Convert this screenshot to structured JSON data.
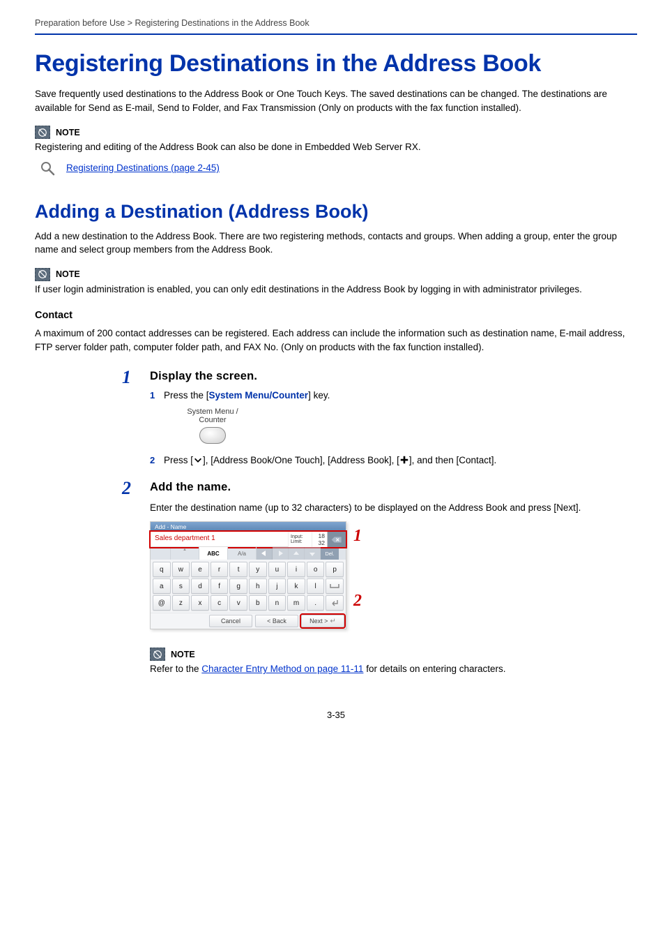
{
  "breadcrumb": "Preparation before Use > Registering Destinations in the Address Book",
  "h1": "Registering Destinations in the Address Book",
  "intro": "Save frequently used destinations to the Address Book or One Touch Keys. The saved destinations can be changed. The destinations are available for Send as E-mail, Send to Folder, and Fax Transmission (Only on products with the fax function installed).",
  "note_label": "NOTE",
  "note1_text": "Registering and editing of the Address Book can also be done in Embedded Web Server RX.",
  "ref1_link": "Registering Destinations (page 2-45)",
  "h2": "Adding a Destination (Address Book)",
  "h2_intro": "Add a new destination to the Address Book. There are two registering methods, contacts and groups. When adding a group, enter the group name and select group members from the Address Book.",
  "note2_text": "If user login administration is enabled, you can only edit destinations in the Address Book by logging in with administrator privileges.",
  "contact_heading": "Contact",
  "contact_text": "A maximum of 200 contact addresses can be registered. Each address can include the information such as destination name, E-mail address, FTP server folder path, computer folder path, and FAX No. (Only on products with the fax function installed).",
  "step1": {
    "num": "1",
    "title": "Display the screen.",
    "sub1_num": "1",
    "sub1_a": "Press the [",
    "sub1_kw": "System Menu/Counter",
    "sub1_b": "] key.",
    "key_label_top": "System Menu /",
    "key_label_bot": "Counter",
    "sub2_num": "2",
    "sub2_text_a": "Press [",
    "sub2_text_b": "], [Address Book/One Touch], [Address Book], [",
    "sub2_text_c": "], and then [Contact]."
  },
  "step2": {
    "num": "2",
    "title": "Add the name.",
    "desc": "Enter the destination name (up to 32 characters) to be displayed on the Address Book and press [Next].",
    "callout1": "1",
    "callout2": "2"
  },
  "kbd": {
    "titlebar": "Add - Name",
    "input_value": "Sales department 1",
    "limit_label_top": "Input:",
    "limit_label_bot": "Limit:",
    "limit_val_top": "18",
    "limit_val_bot": "32",
    "tab_abc": "ABC",
    "tab_aa": "A/a",
    "del_label": "Del.",
    "rows": [
      [
        "q",
        "w",
        "e",
        "r",
        "t",
        "y",
        "u",
        "i",
        "o",
        "p"
      ],
      [
        "a",
        "s",
        "d",
        "f",
        "g",
        "h",
        "j",
        "k",
        "l",
        "_"
      ],
      [
        "@",
        "z",
        "x",
        "c",
        "v",
        "b",
        "n",
        "m",
        ".",
        "↵"
      ]
    ],
    "btn_cancel": "Cancel",
    "btn_back": "< Back",
    "btn_next": "Next >"
  },
  "note3_a": "Refer to the ",
  "note3_link": "Character Entry Method on page 11-11",
  "note3_b": " for details on entering characters.",
  "page_number": "3-35"
}
